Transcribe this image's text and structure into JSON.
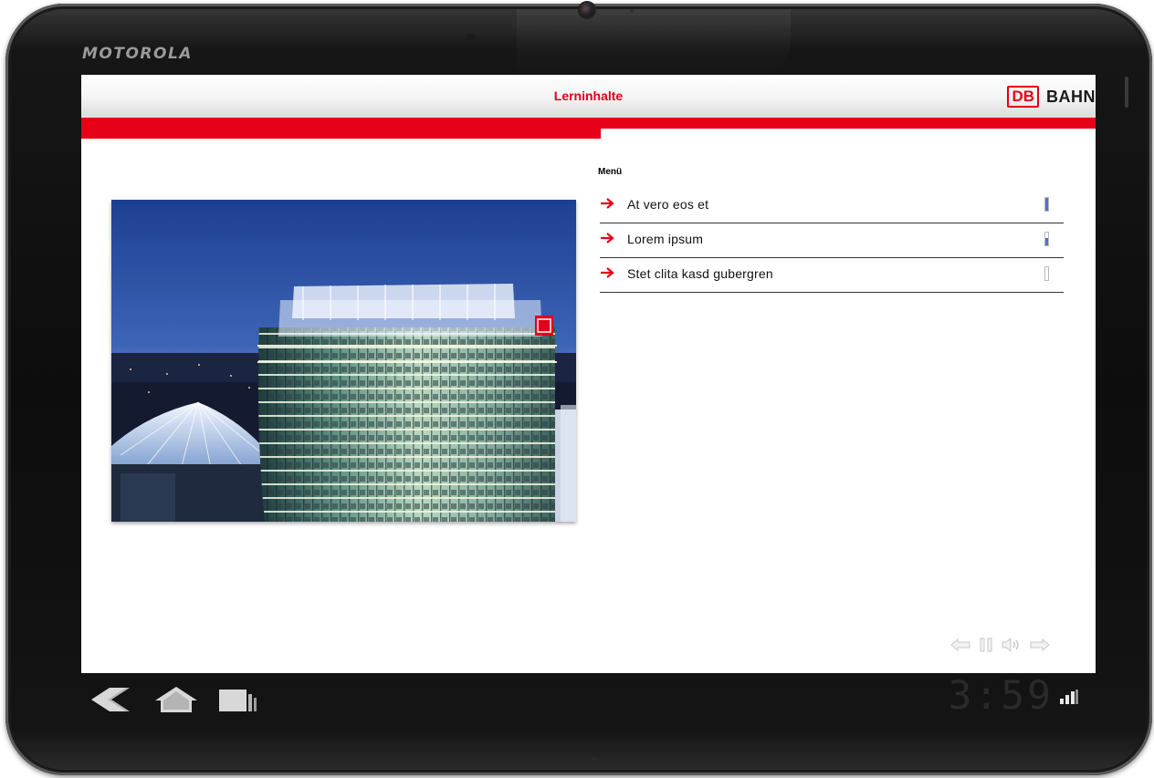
{
  "device": {
    "brand": "MOTOROLA"
  },
  "header": {
    "title": "Lerninhalte",
    "logo_box": "DB",
    "logo_text": "BAHN"
  },
  "colors": {
    "accent_red": "#e60018",
    "indicator_blue": "#4f74c6"
  },
  "progress": {
    "fraction": 0.512
  },
  "hero": {
    "icon": "db-headquarters-photo"
  },
  "menu": {
    "title": "Menü",
    "items": [
      {
        "label": "At vero eos et",
        "progress": 1.0
      },
      {
        "label": "Lorem ipsum",
        "progress": 0.55
      },
      {
        "label": "Stet clita kasd gubergren",
        "progress": 0.0
      }
    ]
  },
  "media_controls": [
    "back-arrow-icon",
    "pause-icon",
    "volume-icon",
    "forward-arrow-icon"
  ],
  "system_bar": {
    "time": "3:59",
    "icons": [
      "back-icon",
      "home-icon",
      "recent-apps-icon",
      "signal-icon"
    ]
  }
}
